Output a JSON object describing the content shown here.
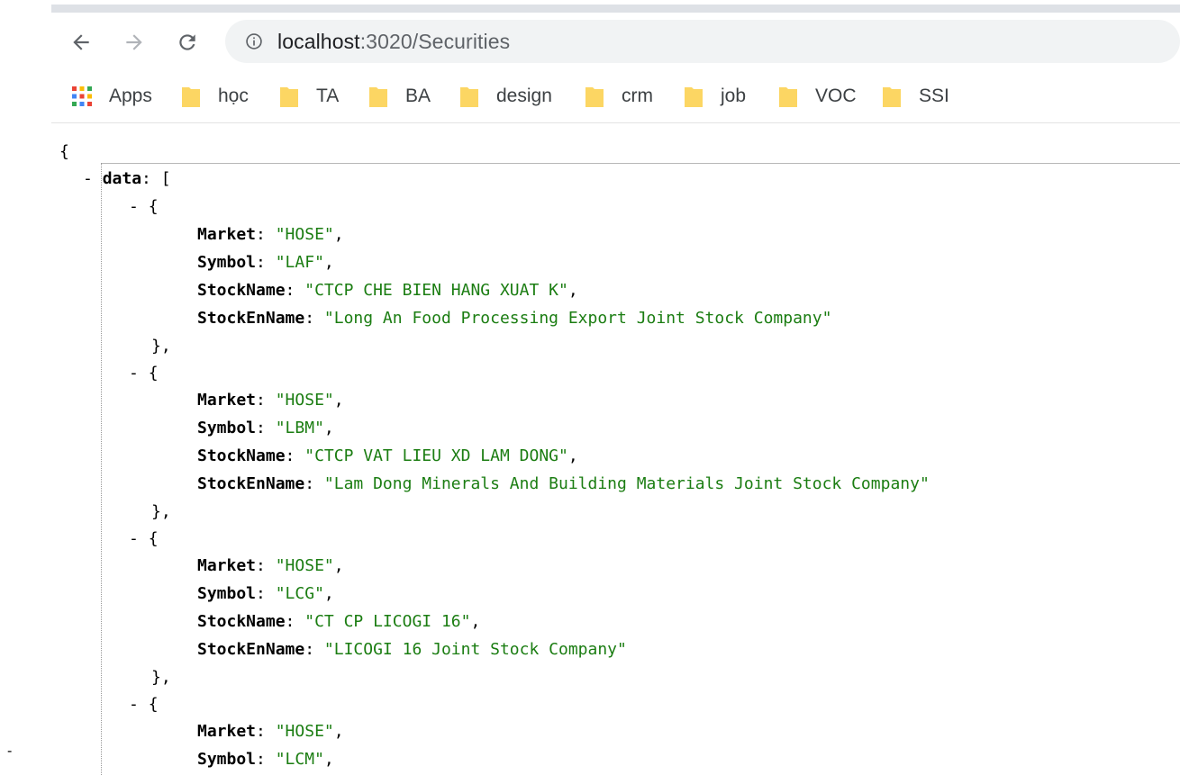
{
  "browser": {
    "url_host": "localhost",
    "url_path": ":3020/Securities",
    "nav": [
      "back-icon",
      "forward-icon",
      "reload-icon",
      "info-icon"
    ]
  },
  "bookmarks": {
    "apps_label": "Apps",
    "folders": [
      "học",
      "TA",
      "BA",
      "design",
      "crm",
      "job",
      "VOC",
      "SSI"
    ],
    "folder_color": "#fcd663"
  },
  "json_view": {
    "open_brace": "{",
    "root_key": "data",
    "items": [
      {
        "Market": "\"HOSE\"",
        "Symbol": "\"LAF\"",
        "StockName": "\"CTCP CHE BIEN HANG XUAT K\"",
        "StockEnName": "\"Long An Food Processing Export Joint Stock Company\""
      },
      {
        "Market": "\"HOSE\"",
        "Symbol": "\"LBM\"",
        "StockName": "\"CTCP VAT LIEU XD LAM DONG\"",
        "StockEnName": "\"Lam Dong Minerals And Building Materials Joint Stock Company\""
      },
      {
        "Market": "\"HOSE\"",
        "Symbol": "\"LCG\"",
        "StockName": "\"CT CP LICOGI 16\"",
        "StockEnName": "\"LICOGI 16 Joint Stock Company\""
      },
      {
        "Market": "\"HOSE\"",
        "Symbol": "\"LCM\""
      }
    ],
    "string_color": "#1b7d12"
  },
  "stray_mark": "-"
}
